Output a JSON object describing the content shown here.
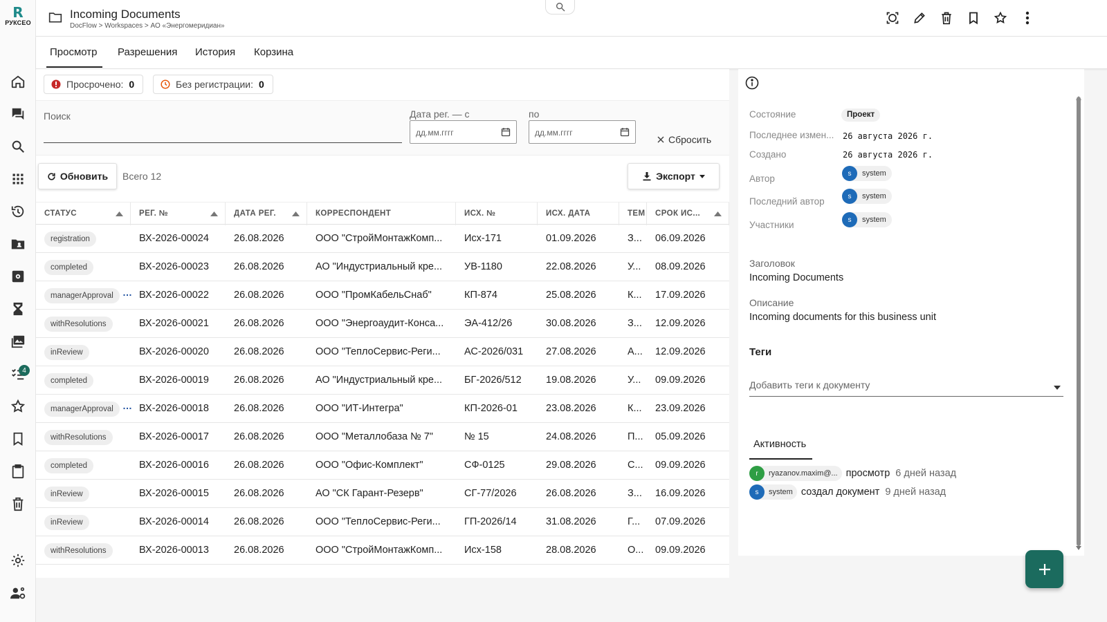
{
  "brand": {
    "mark": "R",
    "name": "РУКСЕО"
  },
  "rail": {
    "icons": [
      "home-icon",
      "chat-icon",
      "search-icon",
      "apps-icon",
      "history-icon",
      "shared-folder-icon",
      "settings-box-icon",
      "hourglass-icon",
      "gallery-icon",
      "tasks-icon",
      "star-icon",
      "bookmark-icon",
      "clipboard-icon",
      "trash-icon",
      "gear-icon",
      "user-settings-icon"
    ],
    "tasks_badge": "4"
  },
  "header": {
    "title": "Incoming Documents",
    "breadcrumb": "DocFlow > Workspaces > АО «Энергомеридиан»",
    "actions": [
      "focus-icon",
      "edit-icon",
      "delete-icon",
      "bookmark-icon",
      "star-icon",
      "more-vert-icon"
    ]
  },
  "tabs": [
    {
      "label": "Просмотр",
      "active": true
    },
    {
      "label": "Разрешения"
    },
    {
      "label": "История"
    },
    {
      "label": "Корзина"
    }
  ],
  "chips": {
    "overdue": {
      "label": "Просрочено:",
      "value": "0",
      "color": "#c62828"
    },
    "unregistered": {
      "label": "Без регистрации:",
      "value": "0",
      "color": "#e65100"
    }
  },
  "filters": {
    "search_label": "Поиск",
    "date_from_label": "Дата рег. — с",
    "date_to_label": "по",
    "date_placeholder": "дд.мм.гггг",
    "reset_label": "Сбросить"
  },
  "toolbar": {
    "refresh_label": "Обновить",
    "total_label": "Всего 12",
    "export_label": "Экспорт"
  },
  "table": {
    "columns": [
      "СТАТУС",
      "РЕГ. №",
      "ДАТА РЕГ.",
      "КОРРЕСПОНДЕНТ",
      "ИСХ. №",
      "ИСХ. ДАТА",
      "ТЕМ",
      "СРОК ИС..."
    ],
    "rows": [
      {
        "status": "registration",
        "reg": "ВХ-2026-00024",
        "date": "26.08.2026",
        "corr": "ООО \"СтройМонтажКомп...",
        "out": "Исх-171",
        "out_date": "01.09.2026",
        "topic": "З...",
        "due": "06.09.2026",
        "more": false
      },
      {
        "status": "completed",
        "reg": "ВХ-2026-00023",
        "date": "26.08.2026",
        "corr": "АО \"Индустриальный кре...",
        "out": "УВ-1180",
        "out_date": "22.08.2026",
        "topic": "У...",
        "due": "08.09.2026",
        "more": false
      },
      {
        "status": "managerApproval",
        "reg": "ВХ-2026-00022",
        "date": "26.08.2026",
        "corr": "ООО \"ПромКабельСнаб\"",
        "out": "КП-874",
        "out_date": "25.08.2026",
        "topic": "К...",
        "due": "17.09.2026",
        "more": true
      },
      {
        "status": "withResolutions",
        "reg": "ВХ-2026-00021",
        "date": "26.08.2026",
        "corr": "ООО \"Энергоаудит-Конса...",
        "out": "ЭА-412/26",
        "out_date": "30.08.2026",
        "topic": "З...",
        "due": "12.09.2026",
        "more": false
      },
      {
        "status": "inReview",
        "reg": "ВХ-2026-00020",
        "date": "26.08.2026",
        "corr": "ООО \"ТеплоСервис-Реги...",
        "out": "АС-2026/031",
        "out_date": "27.08.2026",
        "topic": "А...",
        "due": "12.09.2026",
        "more": false
      },
      {
        "status": "completed",
        "reg": "ВХ-2026-00019",
        "date": "26.08.2026",
        "corr": "АО \"Индустриальный кре...",
        "out": "БГ-2026/512",
        "out_date": "19.08.2026",
        "topic": "У...",
        "due": "09.09.2026",
        "more": false
      },
      {
        "status": "managerApproval",
        "reg": "ВХ-2026-00018",
        "date": "26.08.2026",
        "corr": "ООО \"ИТ-Интегра\"",
        "out": "КП-2026-01",
        "out_date": "23.08.2026",
        "topic": "К...",
        "due": "23.09.2026",
        "more": true
      },
      {
        "status": "withResolutions",
        "reg": "ВХ-2026-00017",
        "date": "26.08.2026",
        "corr": "ООО \"Металлобаза № 7\"",
        "out": "№ 15",
        "out_date": "24.08.2026",
        "topic": "П...",
        "due": "05.09.2026",
        "more": false
      },
      {
        "status": "completed",
        "reg": "ВХ-2026-00016",
        "date": "26.08.2026",
        "corr": "ООО \"Офис-Комплект\"",
        "out": "СФ-0125",
        "out_date": "29.08.2026",
        "topic": "С...",
        "due": "09.09.2026",
        "more": false
      },
      {
        "status": "inReview",
        "reg": "ВХ-2026-00015",
        "date": "26.08.2026",
        "corr": "АО \"СК Гарант-Резерв\"",
        "out": "СГ-77/2026",
        "out_date": "26.08.2026",
        "topic": "З...",
        "due": "16.09.2026",
        "more": false
      },
      {
        "status": "inReview",
        "reg": "ВХ-2026-00014",
        "date": "26.08.2026",
        "corr": "ООО \"ТеплоСервис-Реги...",
        "out": "ГП-2026/14",
        "out_date": "31.08.2026",
        "topic": "Г...",
        "due": "07.09.2026",
        "more": false
      },
      {
        "status": "withResolutions",
        "reg": "ВХ-2026-00013",
        "date": "26.08.2026",
        "corr": "ООО \"СтройМонтажКомп...",
        "out": "Исх-158",
        "out_date": "28.08.2026",
        "topic": "О...",
        "due": "09.09.2026",
        "more": false
      }
    ]
  },
  "details": {
    "state_label": "Состояние",
    "state_value": "Проект",
    "modified_label": "Последнее измен...",
    "modified_value": "26 августа 2026 г.",
    "created_label": "Создано",
    "created_value": "26 августа 2026 г.",
    "author_label": "Автор",
    "author": "system",
    "last_author_label": "Последний автор",
    "last_author": "system",
    "participants_label": "Участники",
    "participant": "system",
    "avatar_initial": "s",
    "avatar_color": "#1e6bb8",
    "title_label": "Заголовок",
    "title_value": "Incoming Documents",
    "desc_label": "Описание",
    "desc_value": "Incoming documents for this business unit",
    "tags_title": "Теги",
    "tags_placeholder": "Добавить теги к документу"
  },
  "activity": {
    "tab_label": "Активность",
    "items": [
      {
        "initial": "r",
        "color": "#2e9e44",
        "user": "ryazanov.maxim@...",
        "action": "просмотр",
        "when": "6 дней назад"
      },
      {
        "initial": "s",
        "color": "#1e6bb8",
        "user": "system",
        "action": "создал документ",
        "when": "9 дней назад"
      }
    ]
  },
  "colors": {
    "accent": "#1b6b5e",
    "brand": "#1f8a8a"
  }
}
